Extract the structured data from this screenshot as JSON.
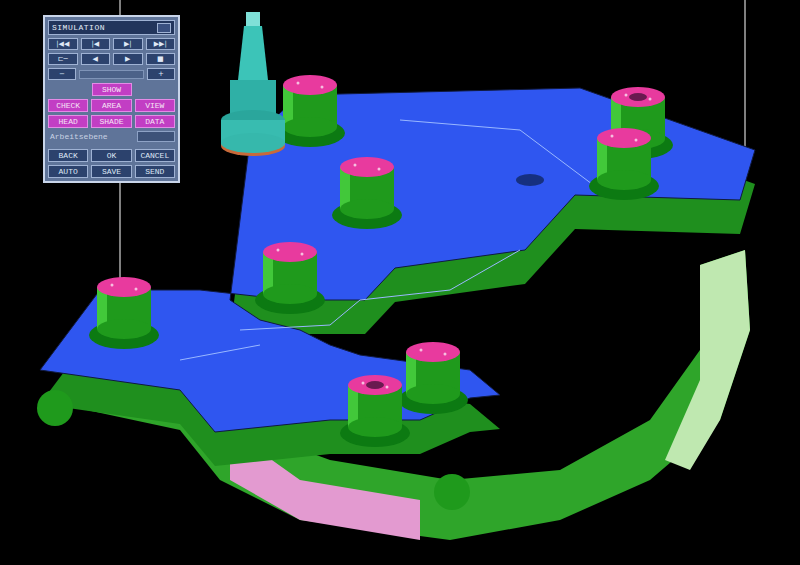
{
  "window": {
    "title": "SIMULATION"
  },
  "transport": [
    {
      "label": "|◀◀"
    },
    {
      "label": "|◀"
    },
    {
      "label": "▶|"
    },
    {
      "label": "▶▶|"
    },
    {
      "label": "⊏─"
    },
    {
      "label": "◀"
    },
    {
      "label": "▶"
    },
    {
      "label": "■"
    }
  ],
  "speed": {
    "minus": "−",
    "plus": "+"
  },
  "show": {
    "label": "SHOW",
    "highlighted": true
  },
  "modes": [
    {
      "label": "CHECK",
      "highlighted": true
    },
    {
      "label": "AREA",
      "highlighted": true
    },
    {
      "label": "VIEW",
      "highlighted": true
    },
    {
      "label": "HEAD",
      "highlighted": true
    },
    {
      "label": "SHADE",
      "highlighted": true
    },
    {
      "label": "DATA",
      "highlighted": true
    }
  ],
  "field": {
    "label": "Arbeitsebene",
    "value": ""
  },
  "actions": [
    {
      "label": "BACK",
      "highlighted": false
    },
    {
      "label": "OK",
      "highlighted": false
    },
    {
      "label": "CANCEL",
      "highlighted": false
    },
    {
      "label": "AUTO",
      "highlighted": false
    },
    {
      "label": "SAVE",
      "highlighted": false
    },
    {
      "label": "SEND",
      "highlighted": false
    }
  ]
}
